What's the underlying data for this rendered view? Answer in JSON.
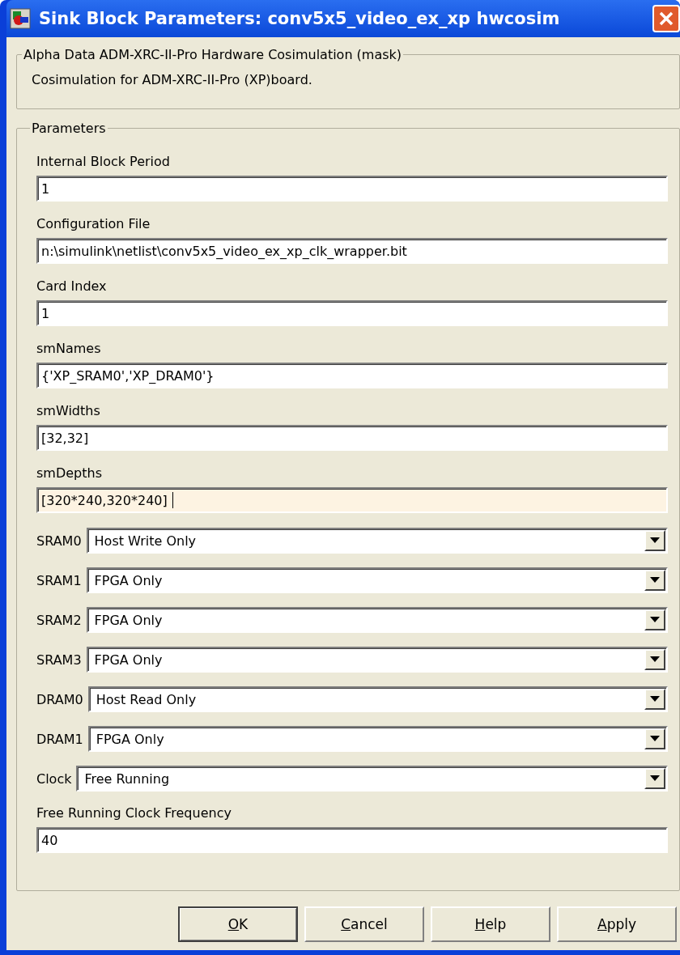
{
  "window": {
    "title": "Sink Block Parameters: conv5x5_video_ex_xp hwcosim"
  },
  "mask": {
    "title": "Alpha Data ADM-XRC-II-Pro Hardware Cosimulation (mask)",
    "description": "Cosimulation for ADM-XRC-II-Pro (XP)board."
  },
  "parameters": {
    "title": "Parameters",
    "items": [
      {
        "kind": "text",
        "label": "Internal Block Period",
        "value": "1",
        "focused": false
      },
      {
        "kind": "text",
        "label": "Configuration File",
        "value": "n:\\simulink\\netlist\\conv5x5_video_ex_xp_clk_wrapper.bit",
        "focused": false
      },
      {
        "kind": "text",
        "label": "Card Index",
        "value": "1",
        "focused": false
      },
      {
        "kind": "text",
        "label": "smNames",
        "value": "{'XP_SRAM0','XP_DRAM0'}",
        "focused": false
      },
      {
        "kind": "text",
        "label": "smWidths",
        "value": "[32,32]",
        "focused": false
      },
      {
        "kind": "text",
        "label": "smDepths",
        "value": "[320*240,320*240]",
        "focused": true
      },
      {
        "kind": "select",
        "label": "SRAM0",
        "value": "Host Write Only"
      },
      {
        "kind": "select",
        "label": "SRAM1",
        "value": "FPGA Only"
      },
      {
        "kind": "select",
        "label": "SRAM2",
        "value": "FPGA Only"
      },
      {
        "kind": "select",
        "label": "SRAM3",
        "value": "FPGA Only"
      },
      {
        "kind": "select",
        "label": "DRAM0",
        "value": "Host Read Only"
      },
      {
        "kind": "select",
        "label": "DRAM1",
        "value": "FPGA Only"
      },
      {
        "kind": "select",
        "label": "Clock",
        "value": "Free Running"
      },
      {
        "kind": "text",
        "label": "Free Running Clock Frequency",
        "value": "40",
        "focused": false
      }
    ]
  },
  "buttons": [
    {
      "label": "OK",
      "default": true
    },
    {
      "label": "Cancel",
      "default": false
    },
    {
      "label": "Help",
      "default": false
    },
    {
      "label": "Apply",
      "default": false
    }
  ]
}
